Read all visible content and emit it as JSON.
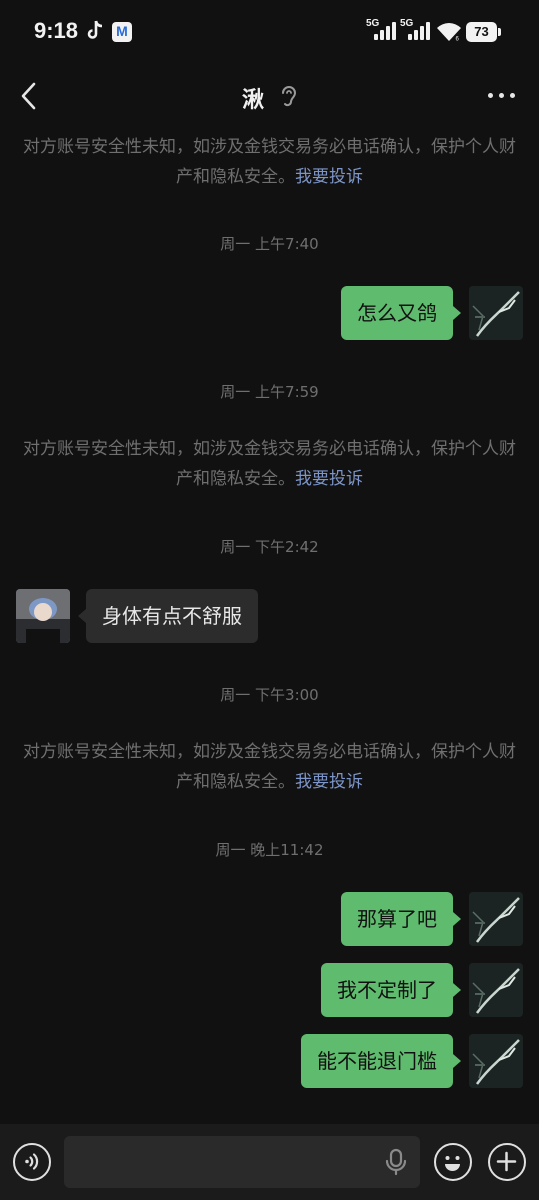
{
  "status_bar": {
    "time": "9:18",
    "network_1": "5G",
    "network_2": "5G",
    "battery": "73",
    "app_icons": [
      "tiktok-icon",
      "mail-icon"
    ]
  },
  "header": {
    "title": "湫"
  },
  "messages": {
    "notice": {
      "text": "对方账号安全性未知，如涉及金钱交易务必电话确认，保护个人财产和隐私安全。",
      "link": "我要投诉"
    },
    "time_1": "周一 上午7:40",
    "msg_1": "怎么又鸽",
    "time_2": "周一 上午7:59",
    "time_3": "周一 下午2:42",
    "msg_2": "身体有点不舒服",
    "time_4": "周一 下午3:00",
    "time_5": "周一 晚上11:42",
    "msg_3": "那算了吧",
    "msg_4": "我不定制了",
    "msg_5": "能不能退门槛"
  },
  "input_bar": {
    "value": ""
  },
  "colors": {
    "background": "#111111",
    "my_bubble": "#5fbb6d",
    "their_bubble": "#2c2c2c",
    "link": "#7d95c8"
  }
}
